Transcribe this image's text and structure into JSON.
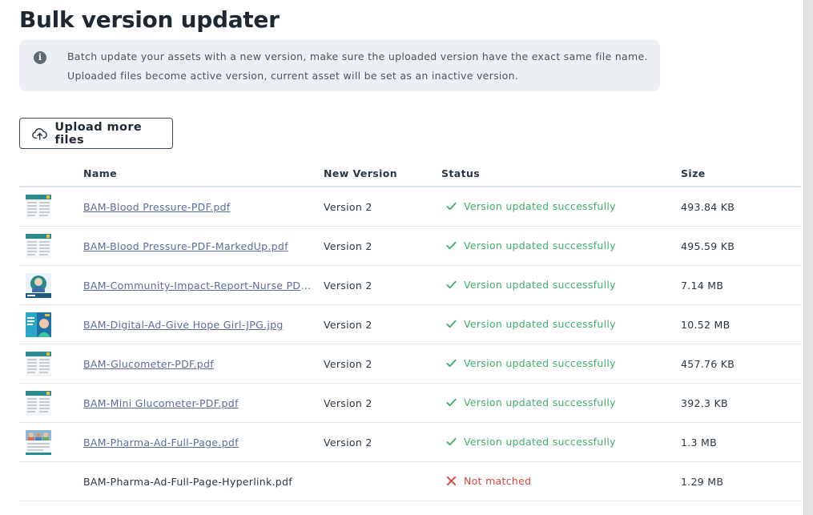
{
  "page": {
    "title": "Bulk version updater"
  },
  "info": {
    "icon": "info-icon",
    "line1": "Batch update your assets with a new version, make sure the uploaded version have the exact same file name.",
    "line2": "Uploaded files become active version, current asset will be set as an inactive version."
  },
  "upload_button": {
    "label": "Upload more files",
    "icon": "cloud-upload-icon"
  },
  "table": {
    "headers": {
      "name": "Name",
      "new_version": "New Version",
      "status": "Status",
      "size": "Size"
    },
    "rows": [
      {
        "name": "BAM-Blood Pressure-PDF.pdf",
        "version": "Version 2",
        "status": "Version updated successfully",
        "state": "success",
        "size": "493.84 KB",
        "thumb": "pdf"
      },
      {
        "name": "BAM-Blood Pressure-PDF-MarkedUp.pdf",
        "version": "Version 2",
        "status": "Version updated successfully",
        "state": "success",
        "size": "495.59 KB",
        "thumb": "pdf"
      },
      {
        "name": "BAM-Community-Impact-Report-Nurse PDF.pdf",
        "version": "Version 2",
        "status": "Version updated successfully",
        "state": "success",
        "size": "7.14 MB",
        "thumb": "report"
      },
      {
        "name": "BAM-Digital-Ad-Give Hope Girl-JPG.jpg",
        "version": "Version 2",
        "status": "Version updated successfully",
        "state": "success",
        "size": "10.52 MB",
        "thumb": "ad"
      },
      {
        "name": "BAM-Glucometer-PDF.pdf",
        "version": "Version 2",
        "status": "Version updated successfully",
        "state": "success",
        "size": "457.76 KB",
        "thumb": "pdf"
      },
      {
        "name": "BAM-Mini Glucometer-PDF.pdf",
        "version": "Version 2",
        "status": "Version updated successfully",
        "state": "success",
        "size": "392.3 KB",
        "thumb": "pdf"
      },
      {
        "name": "BAM-Pharma-Ad-Full-Page.pdf",
        "version": "Version 2",
        "status": "Version updated successfully",
        "state": "success",
        "size": "1.3 MB",
        "thumb": "photo"
      },
      {
        "name": "BAM-Pharma-Ad-Full-Page-Hyperlink.pdf",
        "version": "",
        "status": "Not matched",
        "state": "error",
        "size": "1.29 MB",
        "thumb": ""
      }
    ]
  },
  "colors": {
    "success": "#3fae6a",
    "error": "#d9453e",
    "link": "#5b6ba0",
    "info_bg": "#eceff3"
  }
}
